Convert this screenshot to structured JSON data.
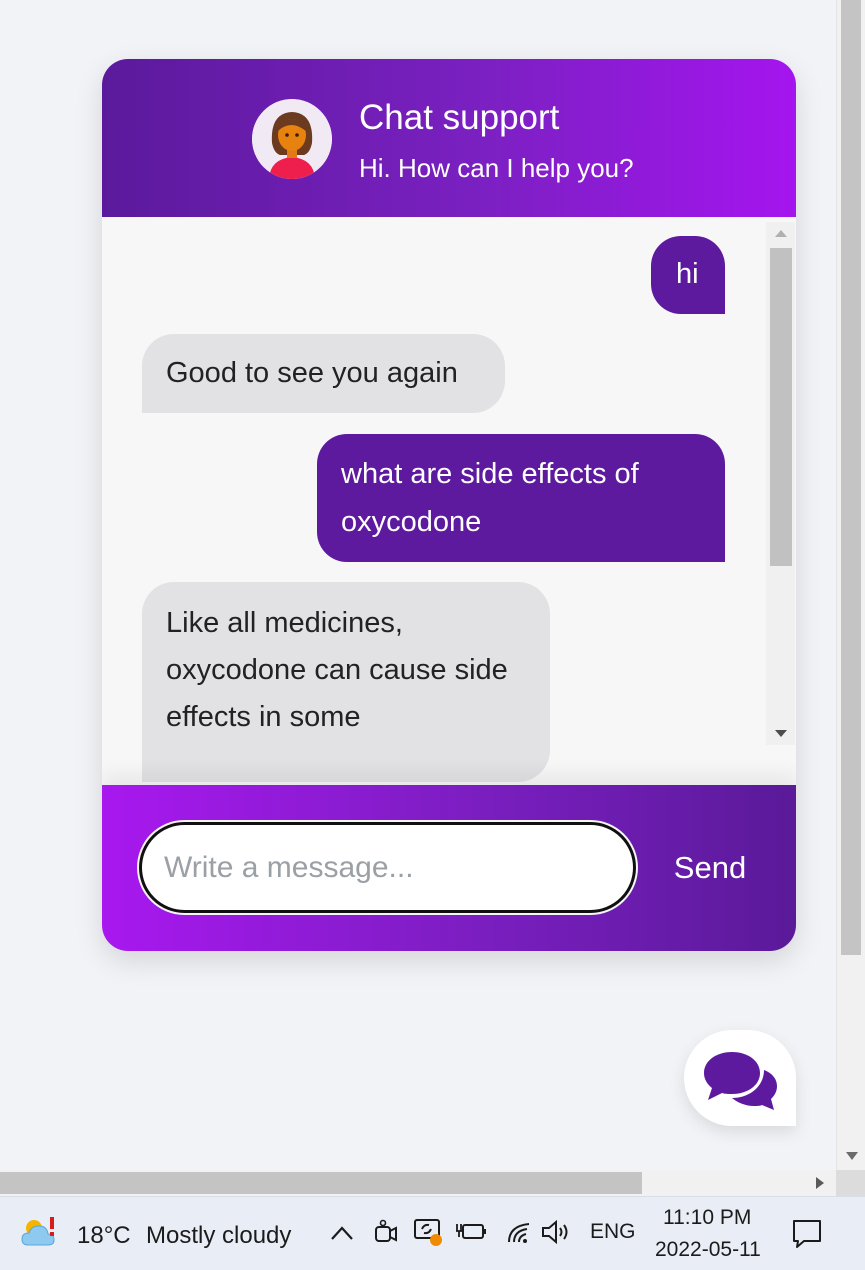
{
  "chat": {
    "title": "Chat support",
    "subtitle": "Hi. How can I help you?",
    "messages": [
      {
        "role": "user",
        "text": "hi"
      },
      {
        "role": "bot",
        "text": "Good to see you again"
      },
      {
        "role": "user",
        "text": "what are side effects of oxycodone"
      },
      {
        "role": "bot",
        "text": "Like all medicines, oxycodone can cause side effects in some"
      }
    ],
    "input": {
      "placeholder": "Write a message...",
      "value": ""
    },
    "send_label": "Send"
  },
  "launcher": {
    "icon": "chat-bubbles-icon"
  },
  "taskbar": {
    "weather_temp": "18°C",
    "weather_desc": "Mostly cloudy",
    "language": "ENG",
    "time": "11:10 PM",
    "date": "2022-05-11"
  },
  "colors": {
    "header_start": "#5b1a9c",
    "header_end": "#a515ef",
    "user_bubble": "#5e1a9f",
    "bot_bubble": "#e2e2e4"
  }
}
